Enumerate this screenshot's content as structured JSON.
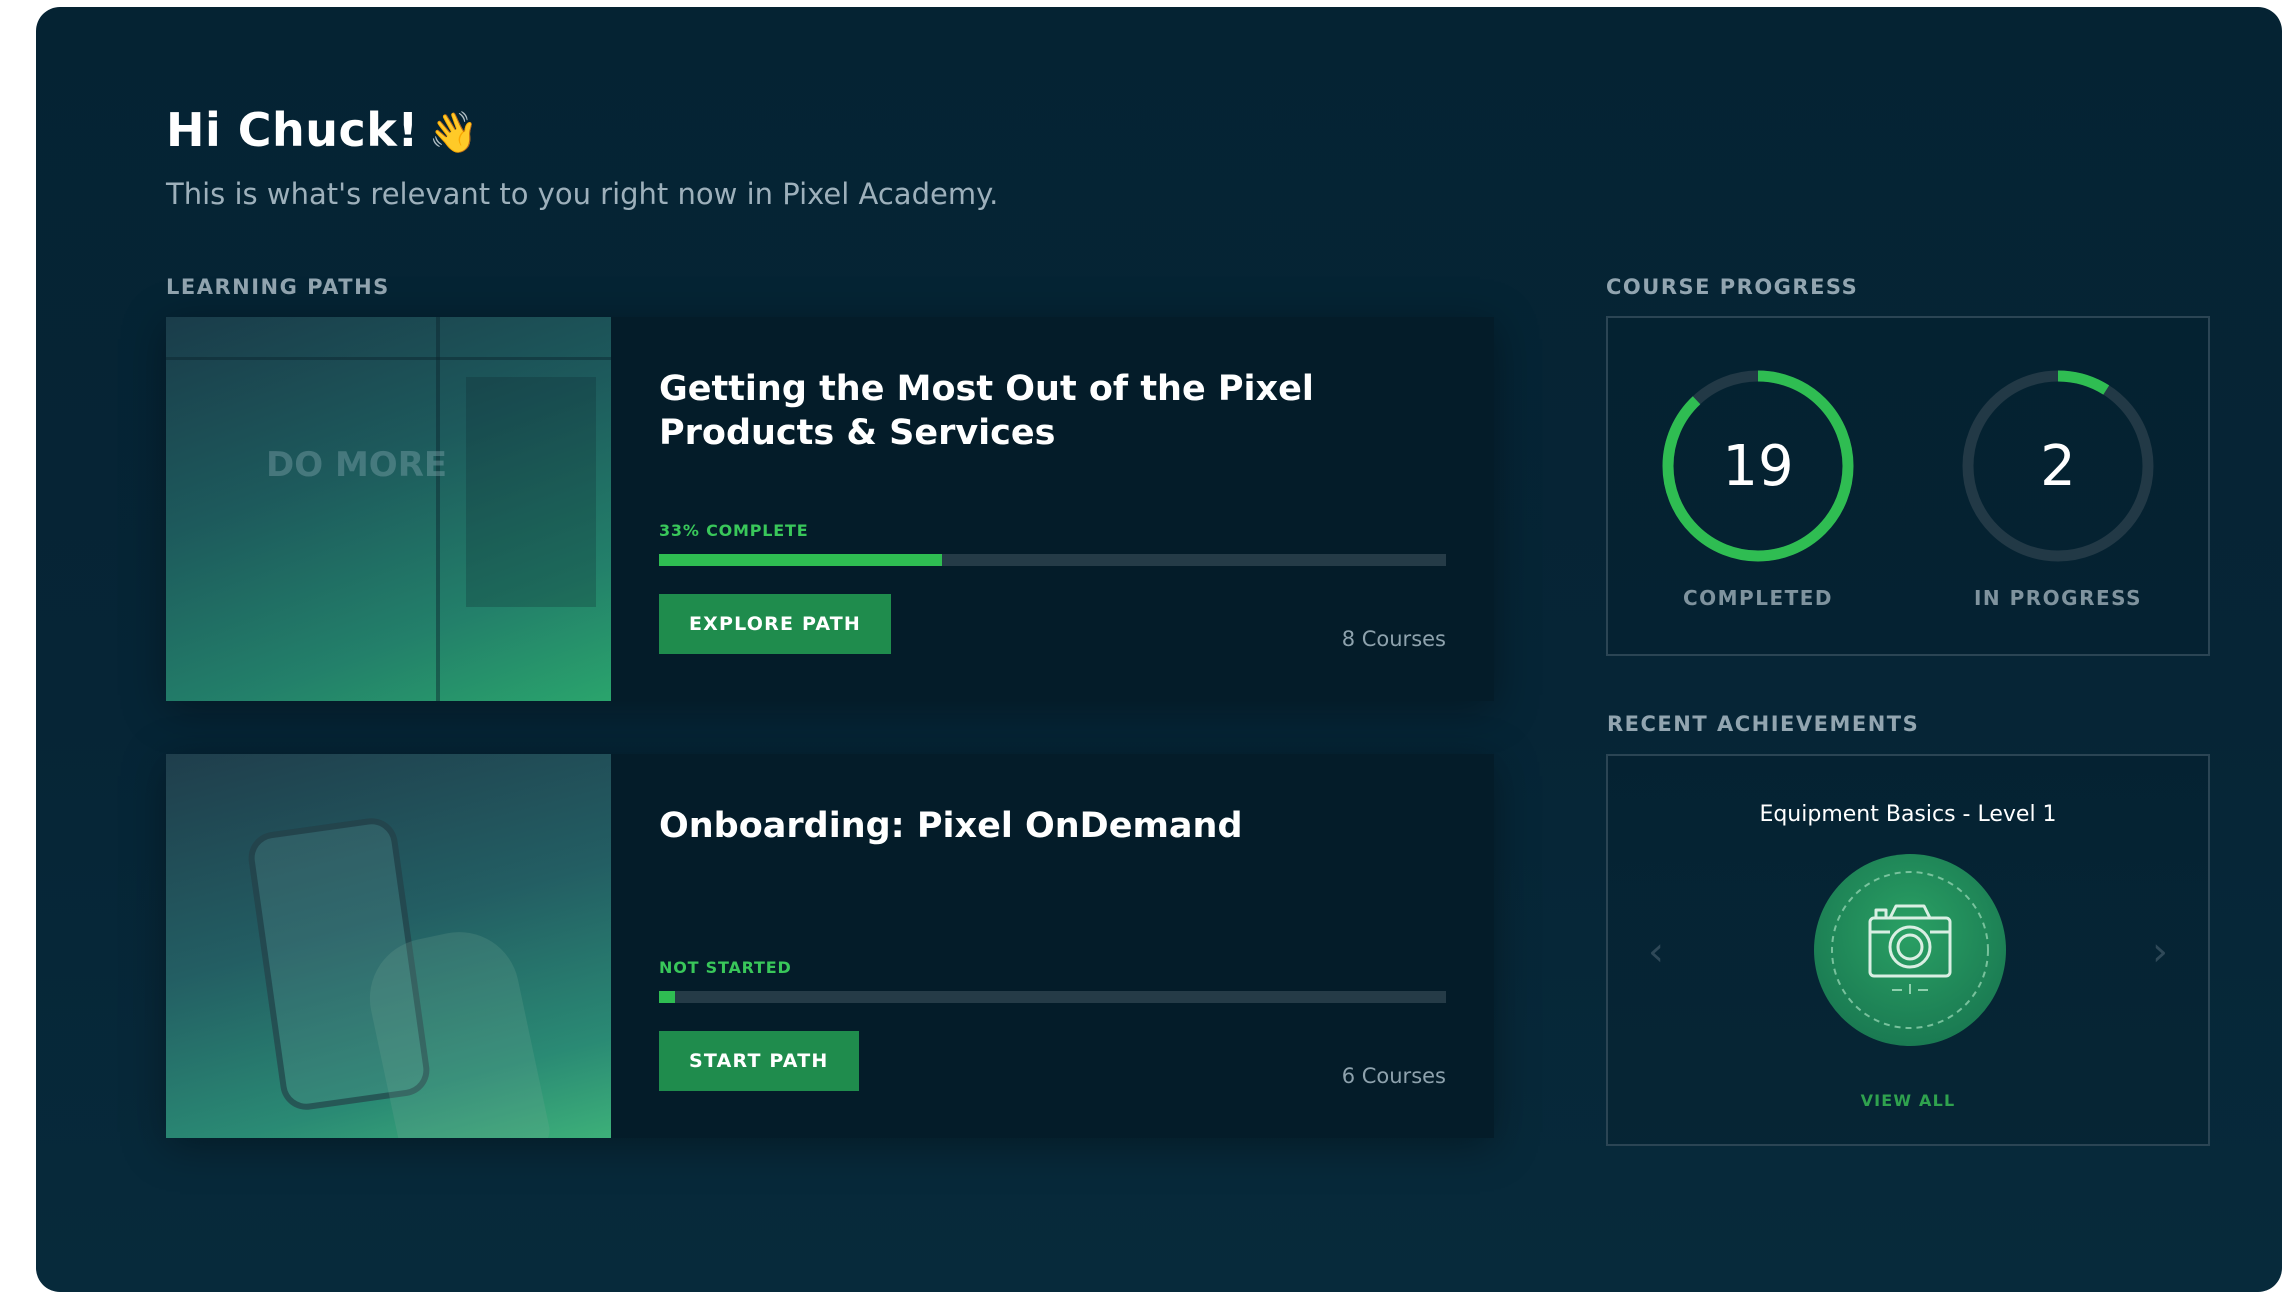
{
  "header": {
    "greeting": "Hi Chuck!",
    "greeting_emoji": "👋",
    "subtitle": "This is what's relevant to you right now in Pixel Academy."
  },
  "learning_paths": {
    "label": "LEARNING PATHS",
    "items": [
      {
        "image": "office-photo",
        "image_text": "DO MORE",
        "title": "Getting the Most Out of the Pixel Products & Services",
        "status": "33% COMPLETE",
        "progress": 0.36,
        "button": "EXPLORE PATH",
        "courses": "8 Courses"
      },
      {
        "image": "phone-photo",
        "title": "Onboarding: Pixel OnDemand",
        "status": "NOT STARTED",
        "progress": 0.02,
        "button": "START PATH",
        "courses": "6 Courses"
      }
    ]
  },
  "course_progress": {
    "label": "COURSE PROGRESS",
    "completed": {
      "value": "19",
      "label": "COMPLETED",
      "fraction": 0.88
    },
    "in_progress": {
      "value": "2",
      "label": "IN PROGRESS",
      "fraction": 0.09
    },
    "ring_color": "#2fbd52",
    "track_color": "#223946"
  },
  "achievements": {
    "label": "RECENT ACHIEVEMENTS",
    "title": "Equipment Basics - Level 1",
    "badge_icon": "camera-icon",
    "view_all": "VIEW ALL",
    "prev_icon": "chevron-left-icon",
    "next_icon": "chevron-right-icon"
  },
  "colors": {
    "background": "#052333",
    "card": "#041c29",
    "accent_green": "#2fbd52",
    "button_green": "#1f8c4d"
  }
}
